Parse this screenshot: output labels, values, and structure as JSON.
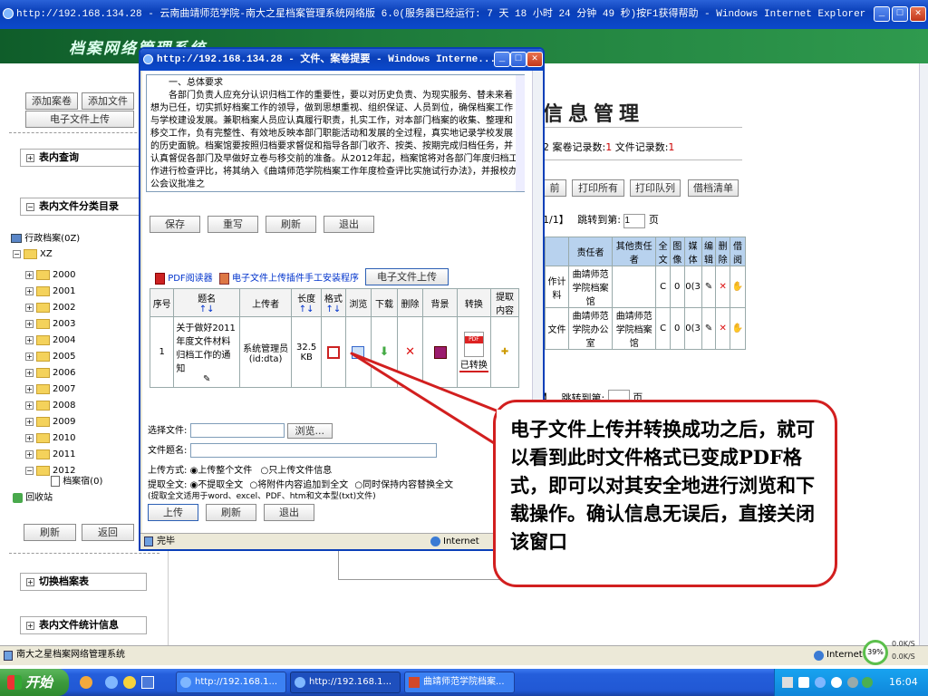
{
  "main_window": {
    "title": "http://192.168.134.28 - 云南曲靖师范学院-南大之星档案管理系统网络版 6.0(服务器已经运行: 7 天 18 小时 24 分钟 49 秒)按F1获得帮助 - Windows Internet Explorer",
    "banner_title": "档案网络管理系统",
    "status_text": "南大之星档案网络管理系统",
    "status_zone": "Internet"
  },
  "sidebar": {
    "btn_add_archive": "添加案卷",
    "btn_add_file": "添加文件",
    "btn_upload": "电子文件上传",
    "section_query": "表内查询",
    "section_category": "表内文件分类目录",
    "tree_root": "行政档案(0Z)",
    "tree_sub": "XZ",
    "years": [
      "2000",
      "2001",
      "2002",
      "2003",
      "2004",
      "2005",
      "2006",
      "2007",
      "2008",
      "2009",
      "2010",
      "2011",
      "2012"
    ],
    "tree_leaf": "档案宿(0)",
    "recycle": "回收站",
    "btn_refresh": "刷新",
    "btn_back": "返回",
    "section_switch": "切换档案表",
    "section_stats": "表内文件统计信息"
  },
  "main_content": {
    "heading": "信息管理",
    "record_info_prefix": "2 案卷记录数:",
    "archive_count": "1",
    "file_record_label": "文件记录数:",
    "file_count": "1",
    "btn_prev": "前",
    "btn_print_all": "打印所有",
    "btn_print_list": "打印队列",
    "btn_borrow": "借档清单",
    "page_info": "1/1】",
    "jump_label": "跳转到第:",
    "jump_value": "1",
    "page_unit": "页",
    "headers": [
      "责任者",
      "其他责任者",
      "全文",
      "图像",
      "媒体",
      "编辑",
      "删除",
      "借阅"
    ],
    "rows": [
      {
        "lead": "作计料",
        "resp": "曲靖师范学院档案馆",
        "other": "",
        "full": "C",
        "img": "0",
        "media": "0(3"
      },
      {
        "lead": "文件",
        "resp": "曲靖师范学院办公室",
        "other": "曲靖师范学院档案馆",
        "full": "C",
        "img": "0",
        "media": "0(3"
      }
    ],
    "page_info_2": "】",
    "jump_label_2": "跳转到第:",
    "page_unit_2": "页"
  },
  "popup": {
    "title": "http://192.168.134.28 - 文件、案卷提要 - Windows Interne...",
    "text_heading": "一、总体要求",
    "text_body": "各部门负责人应充分认识归档工作的重要性，要以对历史负责、为现实服务、替未来着想为已任，切实抓好档案工作的领导，做到思想重视、组织保证、人员到位，确保档案工作与学校建设发展。兼职档案人员应认真履行职责，扎实工作，对本部门档案的收集、整理和移交工作，负有完整性、有效地反映本部门职能活动和发展的全过程，真实地记录学校发展的历史面貌。档案馆要按照归档要求督促和指导各部门收齐、按类、按期完成归档任务，并认真督促各部门及早做好立卷与移交前的准备。从2012年起，档案馆将对各部门年度归档工作进行检查评比，将其纳入《曲靖师范学院档案工作年度检查评比实施试行办法》，并报校办公会议批准之",
    "btn_save": "保存",
    "btn_reset": "重写",
    "btn_refresh": "刷新",
    "btn_exit": "退出",
    "pdf_reader_label": "PDF阅读器",
    "plugin_label": "电子文件上传插件手工安装程序",
    "upload_tab": "电子文件上传",
    "table_headers": [
      "序号",
      "题名",
      "上传者",
      "长度",
      "格式",
      "浏览",
      "下载",
      "删除",
      "背景",
      "转换",
      "提取内容"
    ],
    "sort_glyphs": [
      "↑↓",
      "↑↓",
      "↑↓"
    ],
    "row": {
      "index": "1",
      "title": "关于做好2011年度文件材料归档工作的通知",
      "uploader": "系统管理员(id:dta)",
      "length": "32.5 KB",
      "converted": "已转换"
    },
    "select_file_label": "选择文件:",
    "browse_btn": "浏览...",
    "file_title_label": "文件题名:",
    "upload_mode_label": "上传方式:",
    "mode_whole": "上传整个文件",
    "mode_info": "只上传文件信息",
    "extract_label": "提取全文:",
    "extract_no": "不提取全文",
    "extract_append": "将附件内容追加到全文",
    "extract_sync": "同时保持内容替换全文",
    "extract_note": "(提取全文适用于word、excel、PDF、htm和文本型(txt)文件)",
    "btn_upload": "上传",
    "btn_refresh2": "刷新",
    "btn_exit2": "退出",
    "status_left": "完毕",
    "status_zone": "Internet"
  },
  "callout": {
    "text": "电子文件上传并转换成功之后，就可以看到此时文件格式已变成PDF格式，即可以对其安全地进行浏览和下载操作。确认信息无误后，直接关闭该窗口",
    "border_color": "#d21f1f"
  },
  "taskbar": {
    "start_label": "开始",
    "items": [
      "http://192.168.1...",
      "http://192.168.1...",
      "曲靖师范学院档案..."
    ],
    "clock": "16:04",
    "net_percent": "39%",
    "net_up": "0.0K/S",
    "net_down": "0.0K/S"
  }
}
